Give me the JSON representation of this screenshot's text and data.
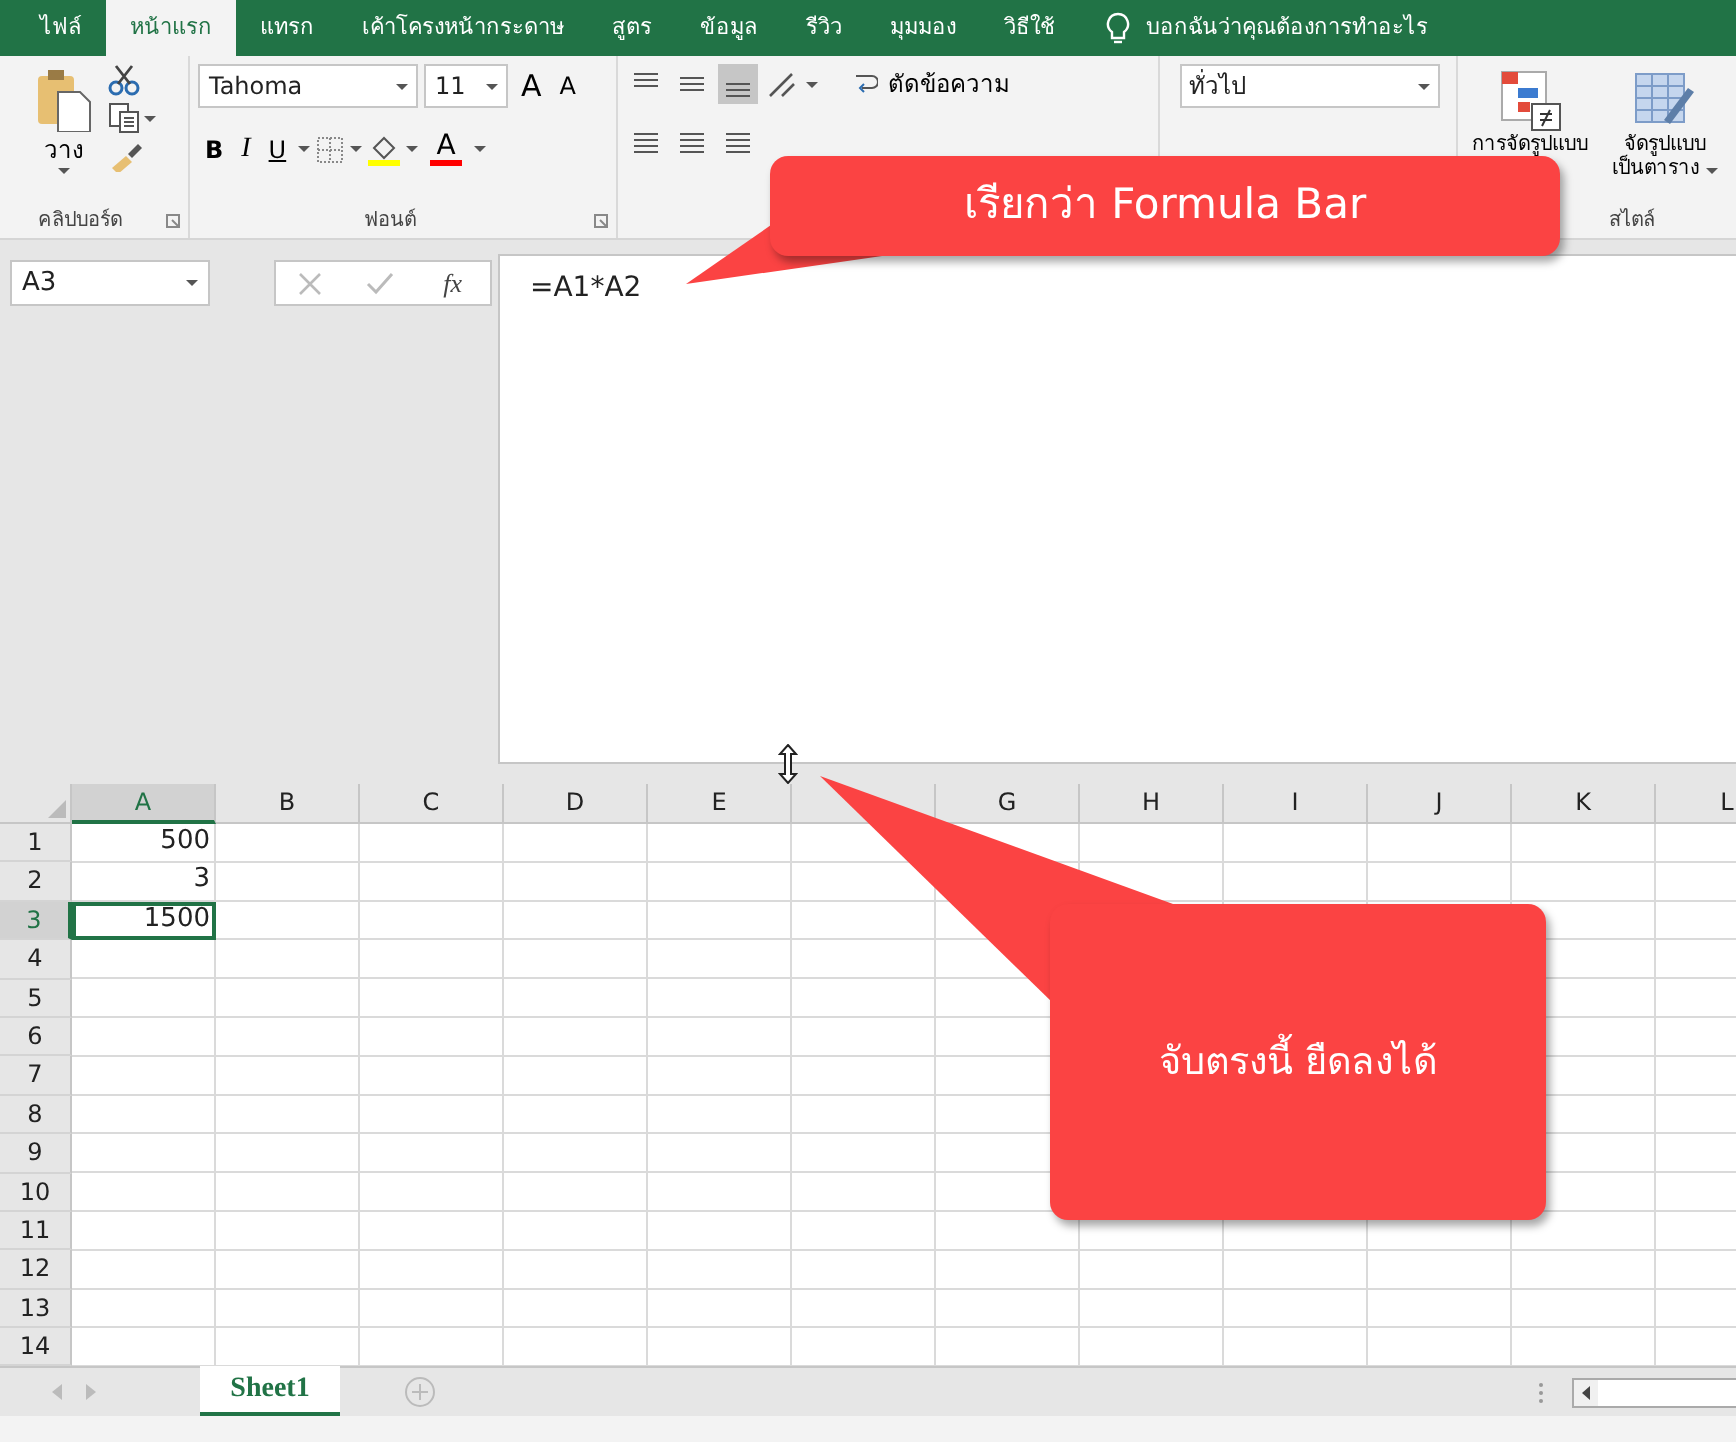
{
  "ribbon_tabs": [
    {
      "label": "ไฟล์",
      "selected": false
    },
    {
      "label": "หน้าแรก",
      "selected": true
    },
    {
      "label": "แทรก",
      "selected": false
    },
    {
      "label": "เค้าโครงหน้ากระดาษ",
      "selected": false
    },
    {
      "label": "สูตร",
      "selected": false
    },
    {
      "label": "ข้อมูล",
      "selected": false
    },
    {
      "label": "รีวิว",
      "selected": false
    },
    {
      "label": "มุมมอง",
      "selected": false
    },
    {
      "label": "วิธีใช้",
      "selected": false
    }
  ],
  "tell_me": {
    "text": "บอกฉันว่าคุณต้องการทำอะไร"
  },
  "ribbon": {
    "clipboard": {
      "paste_label": "วาง",
      "group_label": "คลิปบอร์ด"
    },
    "font": {
      "name": "Tahoma",
      "size": "11",
      "grow": "A",
      "shrink": "A",
      "bold": "B",
      "italic": "I",
      "underline": "U",
      "font_color": "A",
      "group_label": "ฟอนต์"
    },
    "alignment": {
      "wrap_text": "ตัดข้อความ"
    },
    "number": {
      "format": "ทั่วไป"
    },
    "styles": {
      "conditional_formatting": "การจัดรูปแบบ",
      "format_as_table": [
        "จัดรูปแบบ",
        "เป็นตาราง"
      ],
      "group_label": "สไตล์"
    }
  },
  "formula_bar": {
    "name_box": "A3",
    "function_button": "fx",
    "formula": "=A1*A2"
  },
  "sheet": {
    "columns": [
      {
        "label": "A",
        "selected": true
      },
      {
        "label": "B",
        "selected": false
      },
      {
        "label": "C",
        "selected": false
      },
      {
        "label": "D",
        "selected": false
      },
      {
        "label": "E",
        "selected": false
      },
      {
        "selected": false
      },
      {
        "label": "G",
        "selected": false
      },
      {
        "label": "H",
        "selected": false
      },
      {
        "label": "I",
        "selected": false
      },
      {
        "label": "J",
        "selected": false
      },
      {
        "label": "K",
        "selected": false
      },
      {
        "label": "L",
        "selected": false
      }
    ],
    "rows": [
      {
        "label": "1",
        "selected": false,
        "cells": [
          "500"
        ]
      },
      {
        "label": "2",
        "selected": false,
        "cells": [
          "3"
        ]
      },
      {
        "label": "3",
        "selected": true,
        "cells": [
          "1500"
        ]
      },
      {
        "label": "4",
        "selected": false
      },
      {
        "label": "5",
        "selected": false
      },
      {
        "label": "6",
        "selected": false
      },
      {
        "label": "7",
        "selected": false
      },
      {
        "label": "8",
        "selected": false
      },
      {
        "label": "9",
        "selected": false
      },
      {
        "label": "10",
        "selected": false
      },
      {
        "label": "11",
        "selected": false
      },
      {
        "label": "12",
        "selected": false
      },
      {
        "label": "13",
        "selected": false
      },
      {
        "label": "14",
        "selected": false
      }
    ]
  },
  "sheet_tabs": [
    {
      "label": "Sheet1",
      "selected": true
    }
  ],
  "callouts": [
    {
      "text": "เรียกว่า Formula Bar"
    },
    {
      "text": "จับตรงนี้ ยืดลงได้"
    }
  ]
}
